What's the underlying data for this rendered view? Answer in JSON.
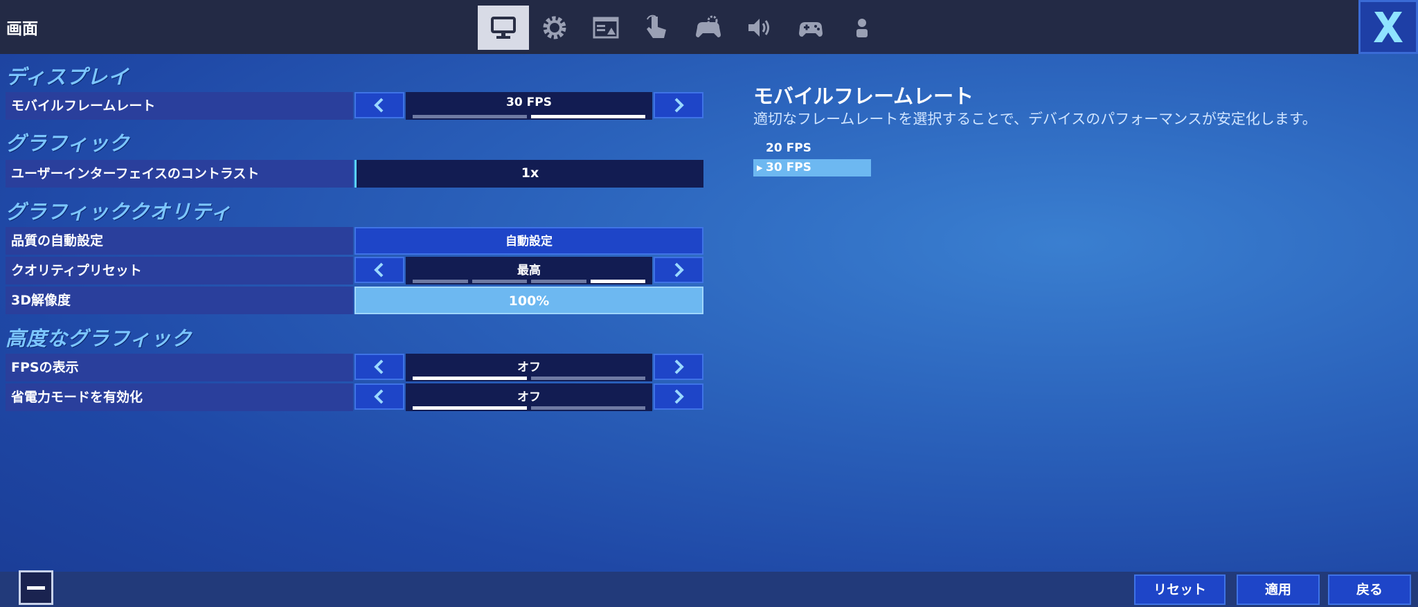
{
  "header": {
    "title": "画面",
    "tabs": [
      {
        "icon": "monitor-icon",
        "active": true
      },
      {
        "icon": "gear-icon",
        "active": false
      },
      {
        "icon": "layout-icon",
        "active": false
      },
      {
        "icon": "touch-icon",
        "active": false
      },
      {
        "icon": "controller-settings-icon",
        "active": false
      },
      {
        "icon": "speaker-icon",
        "active": false
      },
      {
        "icon": "gamepad-icon",
        "active": false
      },
      {
        "icon": "account-icon",
        "active": false
      }
    ],
    "close_icon": "close-x-icon"
  },
  "sections": {
    "display": "ディスプレイ",
    "graphics": "グラフィック",
    "graphics_quality": "グラフィッククオリティ",
    "advanced_graphics": "高度なグラフィック"
  },
  "settings": {
    "mobile_frame_rate": {
      "label": "モバイルフレームレート",
      "value": "30 FPS",
      "option_count": 2,
      "selected_index": 1
    },
    "ui_contrast": {
      "label": "ユーザーインターフェイスのコントラスト",
      "value": "1x"
    },
    "auto_quality": {
      "label": "品質の自動設定",
      "value": "自動設定"
    },
    "quality_preset": {
      "label": "クオリティプリセット",
      "value": "最高",
      "option_count": 4,
      "selected_index": 3
    },
    "resolution_3d": {
      "label": "3D解像度",
      "value": "100%"
    },
    "show_fps": {
      "label": "FPSの表示",
      "value": "オフ",
      "option_count": 2,
      "selected_index": 0
    },
    "power_saving": {
      "label": "省電力モードを有効化",
      "value": "オフ",
      "option_count": 2,
      "selected_index": 0
    }
  },
  "description": {
    "title": "モバイルフレームレート",
    "text": "適切なフレームレートを選択することで、デバイスのパフォーマンスが安定化します。",
    "options": [
      "20 FPS",
      "30 FPS"
    ],
    "selected_index": 1
  },
  "footer": {
    "reset": "リセット",
    "apply": "適用",
    "back": "戻る"
  },
  "colors": {
    "accent_light_blue": "#6db8f1",
    "section_title": "#7cc6ff",
    "button_blue": "#1e45c8",
    "topbar": "#232a45"
  }
}
